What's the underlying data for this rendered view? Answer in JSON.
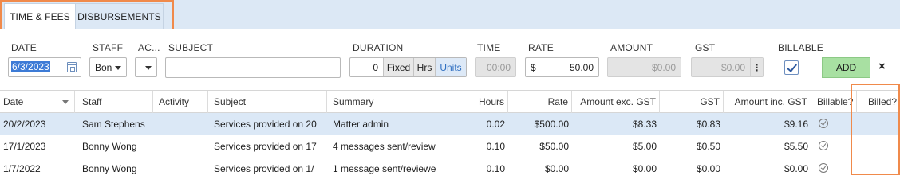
{
  "tabs": [
    {
      "label": "TIME & FEES",
      "active": true
    },
    {
      "label": "DISBURSEMENTS",
      "active": false
    }
  ],
  "form": {
    "labels": {
      "date": "DATE",
      "staff": "STAFF",
      "activity": "AC...",
      "subject": "SUBJECT",
      "duration": "DURATION",
      "time": "TIME",
      "rate": "RATE",
      "amount": "AMOUNT",
      "gst": "GST",
      "billable": "BILLABLE"
    },
    "date_value": "6/3/2023",
    "staff_value": "Bon",
    "activity_value": "",
    "subject_value": "",
    "duration_value": "0",
    "duration_modes": [
      "Fixed",
      "Hrs",
      "Units"
    ],
    "duration_selected": "Units",
    "time_value": "00:00",
    "rate_currency": "$",
    "rate_value": "50.00",
    "amount_value": "$0.00",
    "gst_value": "$0.00",
    "billable_checked": true,
    "add_label": "ADD",
    "close_label": "×"
  },
  "table": {
    "columns": [
      "Date",
      "Staff",
      "Activity",
      "Subject",
      "Summary",
      "Hours",
      "Rate",
      "Amount exc. GST",
      "GST",
      "Amount inc. GST",
      "Billable?",
      "Billed?"
    ],
    "rows": [
      {
        "date": "20/2/2023",
        "staff": "Sam Stephens",
        "activity": "",
        "subject": "Services provided on 20",
        "summary": "Matter admin",
        "hours": "0.02",
        "rate": "$500.00",
        "amount_exc": "$8.33",
        "gst": "$0.83",
        "amount_inc": "$9.16",
        "selected": true
      },
      {
        "date": "17/1/2023",
        "staff": "Bonny Wong",
        "activity": "",
        "subject": "Services provided on 17",
        "summary": "4 messages sent/review",
        "hours": "0.10",
        "rate": "$50.00",
        "amount_exc": "$5.00",
        "gst": "$0.50",
        "amount_inc": "$5.50",
        "selected": false
      },
      {
        "date": "1/7/2022",
        "staff": "Bonny Wong",
        "activity": "",
        "subject": "Services provided on 1/",
        "summary": "1 message sent/reviewe",
        "hours": "0.10",
        "rate": "$0.00",
        "amount_exc": "$0.00",
        "gst": "$0.00",
        "amount_inc": "$0.00",
        "selected": false
      }
    ]
  },
  "colors": {
    "tabbar_bg": "#dce8f5",
    "highlight": "#f08a4b",
    "selected_row": "#dbe8f6",
    "add_button": "#a8e0a2",
    "units_active_text": "#2f6fc0"
  }
}
